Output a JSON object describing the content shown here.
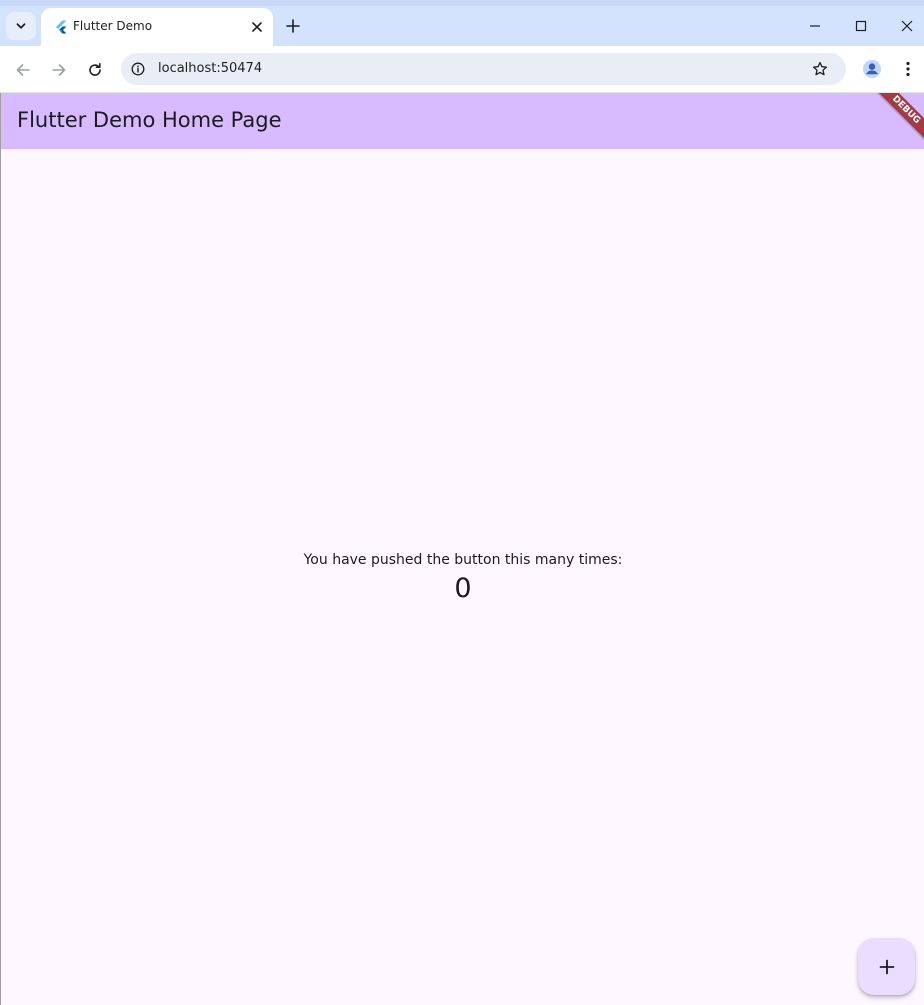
{
  "browser": {
    "tab": {
      "title": "Flutter Demo",
      "favicon": "flutter-icon"
    },
    "address_bar": {
      "url": "localhost:50474"
    },
    "icons": {
      "tab_search": "chevron-down-icon",
      "tab_close": "close-icon",
      "new_tab": "plus-icon",
      "minimize": "minimize-icon",
      "maximize": "maximize-icon",
      "window_close": "close-icon",
      "back": "arrow-left-icon",
      "forward": "arrow-right-icon",
      "reload": "reload-icon",
      "site_info": "info-icon",
      "bookmark": "star-icon",
      "profile": "person-icon",
      "menu": "more-vert-icon"
    }
  },
  "app": {
    "appbar": {
      "title": "Flutter Demo Home Page"
    },
    "debug_banner": "DEBUG",
    "body": {
      "message": "You have pushed the button this many times:",
      "counter": "0"
    },
    "fab": {
      "icon": "plus-icon"
    },
    "colors": {
      "appbar": "#d7baff",
      "background": "#fdf7ff",
      "fab": "#eaddff",
      "debug_banner": "#a63a44"
    }
  }
}
